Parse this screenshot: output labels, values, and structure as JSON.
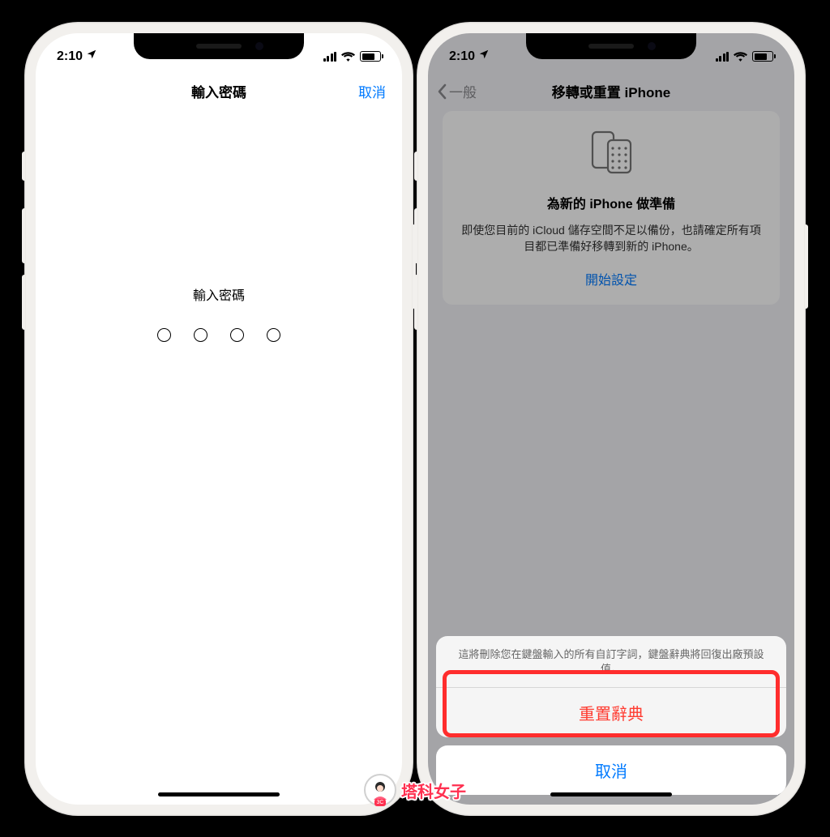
{
  "status": {
    "time": "2:10",
    "location_icon": "location-arrow"
  },
  "screen1": {
    "title": "輸入密碼",
    "cancel": "取消",
    "prompt": "輸入密碼"
  },
  "screen2": {
    "back_label": "一般",
    "title": "移轉或重置 iPhone",
    "card": {
      "title": "為新的 iPhone 做準備",
      "desc": "即使您目前的 iCloud 儲存空間不足以備份，也請確定所有項目都已準備好移轉到新的 iPhone。",
      "link": "開始設定"
    },
    "sheet": {
      "message": "這將刪除您在鍵盤輸入的所有自訂字詞，鍵盤辭典將回復出廠預設值。",
      "destructive": "重置辭典",
      "cancel": "取消"
    }
  },
  "watermark": {
    "text": "塔科女子",
    "tag": "3C"
  }
}
